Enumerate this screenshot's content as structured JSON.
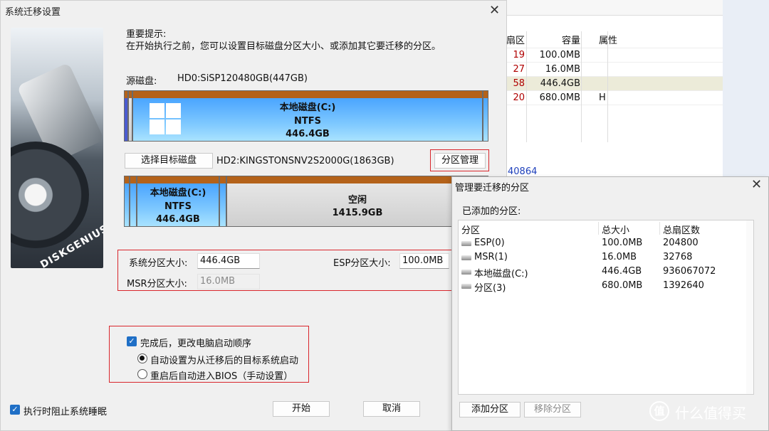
{
  "bg_app": {
    "headers": {
      "sector": "扇区",
      "capacity": "容量",
      "attr": "属性"
    },
    "rows": [
      {
        "sector": "19",
        "capacity": "100.0MB",
        "attr": ""
      },
      {
        "sector": "27",
        "capacity": "16.0MB",
        "attr": ""
      },
      {
        "sector": "58",
        "capacity": "446.4GB",
        "attr": ""
      },
      {
        "sector": "20",
        "capacity": "680.0MB",
        "attr": "H"
      }
    ],
    "link_text": "40864"
  },
  "main_dialog": {
    "title": "系统迁移设置",
    "close_glyph": "✕",
    "brand": "DISKGENIUS",
    "notice_title": "重要提示:",
    "notice_body": "在开始执行之前，您可以设置目标磁盘分区大小、或添加其它要迁移的分区。",
    "source_label": "源磁盘:",
    "source_value": "HD0:SiSP120480GB(447GB)",
    "source_partition": {
      "name": "本地磁盘(C:)",
      "fs": "NTFS",
      "size": "446.4GB"
    },
    "select_target_button": "选择目标磁盘",
    "target_value": "HD2:KINGSTONSNV2S2000G(1863GB)",
    "partition_manage_button": "分区管理",
    "target_partition": {
      "name": "本地磁盘(C:)",
      "fs": "NTFS",
      "size": "446.4GB"
    },
    "free_space": {
      "name": "空闲",
      "size": "1415.9GB"
    },
    "sys_size_label": "系统分区大小:",
    "sys_size_value": "446.4GB",
    "esp_size_label": "ESP分区大小:",
    "esp_size_value": "100.0MB",
    "msr_size_label": "MSR分区大小:",
    "msr_size_value": "16.0MB",
    "after_done_label": "完成后，更改电脑启动顺序",
    "radio_auto": "自动设置为从迁移后的目标系统启动",
    "radio_bios": "重启后自动进入BIOS（手动设置）",
    "prevent_sleep_label": "执行时阻止系统睡眠",
    "start_button": "开始",
    "cancel_button": "取消"
  },
  "partition_dialog": {
    "title": "管理要迁移的分区",
    "close_glyph": "✕",
    "added_label": "已添加的分区:",
    "columns": {
      "partition": "分区",
      "total_size": "总大小",
      "total_sectors": "总扇区数"
    },
    "rows": [
      {
        "partition": "ESP(0)",
        "total_size": "100.0MB",
        "total_sectors": "204800"
      },
      {
        "partition": "MSR(1)",
        "total_size": "16.0MB",
        "total_sectors": "32768"
      },
      {
        "partition": "本地磁盘(C:)",
        "total_size": "446.4GB",
        "total_sectors": "936067072"
      },
      {
        "partition": "分区(3)",
        "total_size": "680.0MB",
        "total_sectors": "1392640"
      }
    ],
    "add_button": "添加分区",
    "remove_button": "移除分区"
  },
  "watermark": {
    "glyph": "值",
    "text": "什么值得买"
  }
}
